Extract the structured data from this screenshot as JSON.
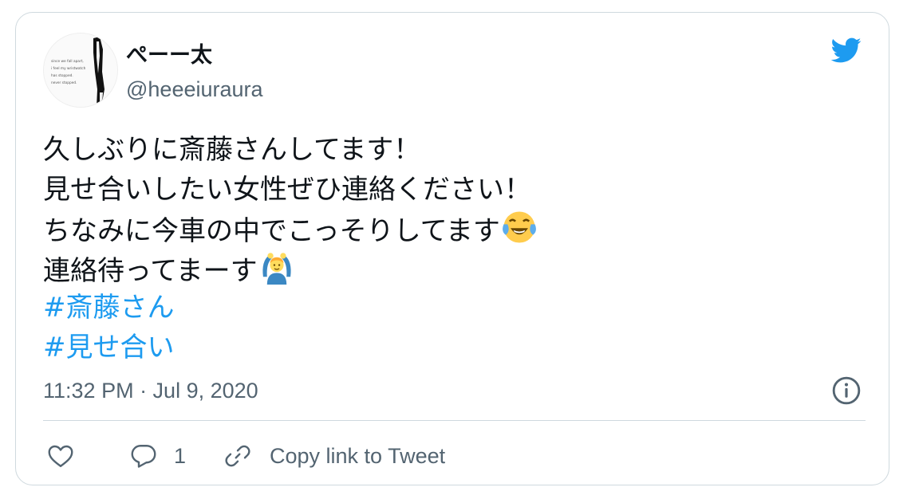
{
  "author": {
    "display_name": "ぺーー太",
    "handle": "@heeeiuraura",
    "avatar_caption": [
      "since we fall apart,",
      "i feel my wristwatch",
      "has stopped.",
      "never stopped."
    ]
  },
  "tweet": {
    "lines": [
      "久しぶりに斎藤さんしてます！",
      "見せ合いしたい女性ぜひ連絡ください！",
      "ちなみに今車の中でこっそりしてます",
      "連絡待ってまーす"
    ],
    "hashtags": [
      "#斎藤さん",
      "#見せ合い"
    ],
    "emojis": [
      "face-with-tears-of-joy",
      "person-gesturing-ok"
    ]
  },
  "meta": {
    "timestamp": "11:32 PM · Jul 9, 2020"
  },
  "actions": {
    "like_count": "",
    "reply_count": "1",
    "copy_link_label": "Copy link to Tweet"
  },
  "colors": {
    "twitter_blue": "#1d9bf0",
    "text_primary": "#0f1419",
    "text_secondary": "#536471",
    "border": "#cfd9de"
  }
}
